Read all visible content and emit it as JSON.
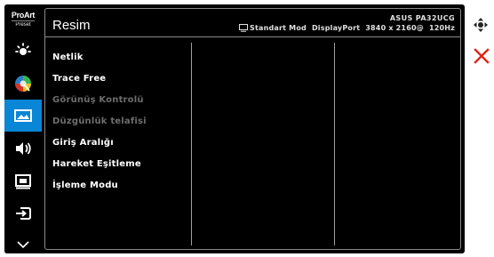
{
  "logo": {
    "line1": "ProArt",
    "line2": "Preset"
  },
  "sidebar": {
    "items": [
      {
        "name": "brightness",
        "icon": "brightness-icon"
      },
      {
        "name": "color",
        "icon": "color-palette-icon"
      },
      {
        "name": "image",
        "icon": "image-icon",
        "active": true
      },
      {
        "name": "sound",
        "icon": "speaker-icon"
      },
      {
        "name": "pip",
        "icon": "pip-icon"
      },
      {
        "name": "input",
        "icon": "input-select-icon"
      },
      {
        "name": "more",
        "icon": "chevron-down-icon"
      }
    ]
  },
  "header": {
    "title": "Resim",
    "model": "ASUS PA32UCG",
    "mode": "Standart Mod",
    "input": "DisplayPort",
    "resolution": "3840 x 2160@",
    "refresh": "120Hz"
  },
  "menu": {
    "items": [
      {
        "label": "Netlik",
        "enabled": true
      },
      {
        "label": "Trace Free",
        "enabled": true
      },
      {
        "label": "Görünüş Kontrolü",
        "enabled": false
      },
      {
        "label": "Düzgünlük telafisi",
        "enabled": false
      },
      {
        "label": "Giriş Aralığı",
        "enabled": true
      },
      {
        "label": "Hareket Eşitleme",
        "enabled": true
      },
      {
        "label": "İşleme Modu",
        "enabled": true
      }
    ]
  },
  "hints": [
    {
      "icon": "navigate-joystick-icon"
    },
    {
      "icon": "close-icon"
    }
  ],
  "colors": {
    "accent": "#0a86d6",
    "close": "#e0261a",
    "disabled": "#6d6d6d"
  }
}
